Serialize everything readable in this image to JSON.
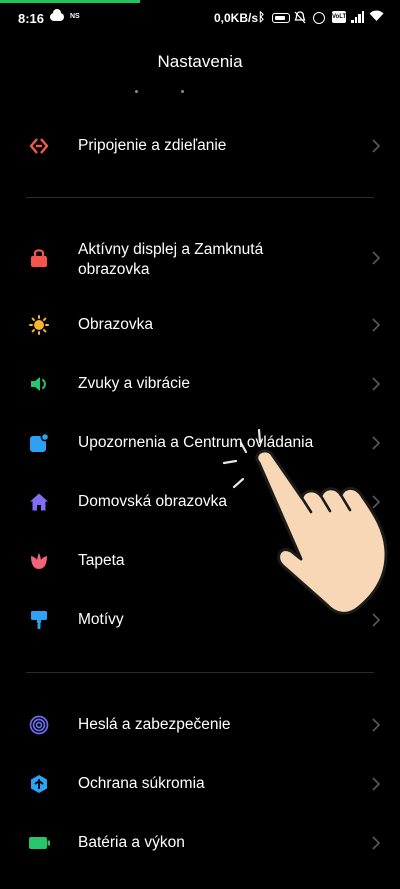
{
  "status_bar": {
    "time": "8:16",
    "ns_label": "NS",
    "net_speed": "0,0KB/s",
    "volte_label": "VoLTE",
    "progress_color": "#21c35a"
  },
  "header": {
    "title": "Nastavenia"
  },
  "sections": [
    {
      "items": [
        {
          "label": "Pripojenie a zdieľanie",
          "icon": "share-arrows-icon",
          "color": "#f05b4b"
        }
      ]
    },
    {
      "items": [
        {
          "label": "Aktívny displej a Zamknutá obrazovka",
          "icon": "lock-icon",
          "color": "#f5544e"
        },
        {
          "label": "Obrazovka",
          "icon": "sun-icon",
          "color": "#f7b531"
        },
        {
          "label": "Zvuky a vibrácie",
          "icon": "speaker-icon",
          "color": "#27c66a"
        },
        {
          "label": "Upozornenia a Centrum ovládania",
          "icon": "notification-icon",
          "color": "#2fa1f5"
        },
        {
          "label": "Domovská obrazovka",
          "icon": "home-icon",
          "color": "#7f6ef5"
        },
        {
          "label": "Tapeta",
          "icon": "tulip-icon",
          "color": "#f3617a"
        },
        {
          "label": "Motívy",
          "icon": "paint-roller-icon",
          "color": "#2fa1f5"
        }
      ]
    },
    {
      "items": [
        {
          "label": "Heslá a zabezpečenie",
          "icon": "fingerprint-icon",
          "color": "#6a6cf0"
        },
        {
          "label": "Ochrana súkromia",
          "icon": "privacy-shield-icon",
          "color": "#2fa1f5"
        },
        {
          "label": "Batéria a výkon",
          "icon": "battery-icon",
          "color": "#27c66a"
        }
      ]
    }
  ],
  "overlay": {
    "gesture": "tap-hand-icon"
  }
}
